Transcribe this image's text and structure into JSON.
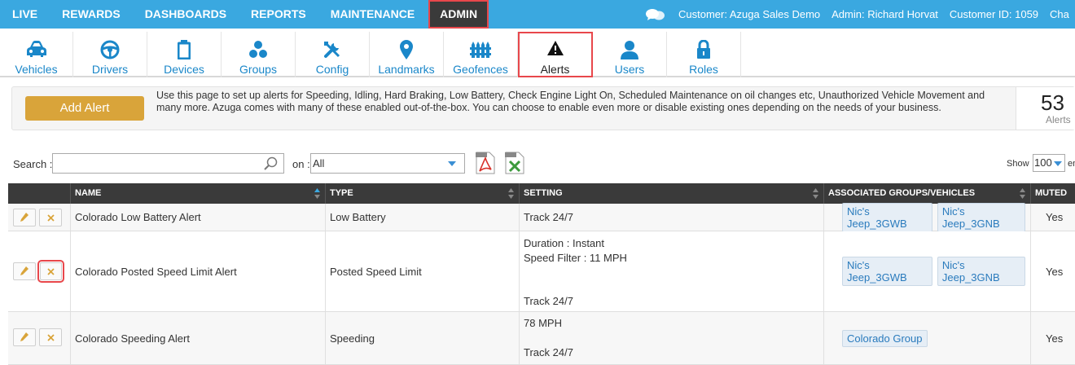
{
  "topnav": {
    "items": [
      "LIVE",
      "REWARDS",
      "DASHBOARDS",
      "REPORTS",
      "MAINTENANCE",
      "ADMIN"
    ],
    "customer": "Customer: Azuga Sales Demo",
    "admin": "Admin: Richard Horvat",
    "customer_id": "Customer ID: 1059",
    "cut_text": "Cha"
  },
  "subnav": {
    "tabs": [
      {
        "label": "Vehicles",
        "icon": "car-icon"
      },
      {
        "label": "Drivers",
        "icon": "steering-wheel-icon"
      },
      {
        "label": "Devices",
        "icon": "device-icon"
      },
      {
        "label": "Groups",
        "icon": "groups-icon"
      },
      {
        "label": "Config",
        "icon": "tools-icon"
      },
      {
        "label": "Landmarks",
        "icon": "map-pin-icon"
      },
      {
        "label": "Geofences",
        "icon": "fence-icon"
      },
      {
        "label": "Alerts",
        "icon": "warning-icon"
      },
      {
        "label": "Users",
        "icon": "user-icon"
      },
      {
        "label": "Roles",
        "icon": "lock-icon"
      }
    ],
    "active": "Alerts"
  },
  "infobar": {
    "add_button": "Add Alert",
    "text": "Use this page to set up alerts for Speeding, Idling, Hard Braking, Low Battery, Check Engine Light On, Scheduled Maintenance on oil changes etc, Unauthorized Vehicle Movement and many more. Azuga comes with many of these enabled out-of-the-box. You can choose to enable even more or disable existing ones depending on the needs of your business.",
    "count": "53",
    "count_label": "Alerts"
  },
  "filters": {
    "search_label": "Search :",
    "search_value": "",
    "on_label": "on :",
    "on_value": "All",
    "show_label": "Show",
    "show_value": "100",
    "entries_label": "en"
  },
  "table": {
    "headers": [
      "NAME",
      "TYPE",
      "SETTING",
      "ASSOCIATED GROUPS/VEHICLES",
      "MUTED"
    ],
    "rows": [
      {
        "name": "Colorado Low Battery Alert",
        "type": "Low Battery",
        "setting": [
          "Track 24/7"
        ],
        "groups": [
          "Nic's Jeep_3GWB",
          "Nic's Jeep_3GNB"
        ],
        "muted": "Yes"
      },
      {
        "name": "Colorado Posted Speed Limit Alert",
        "type": "Posted Speed Limit",
        "setting": [
          "Duration : Instant",
          "Speed Filter : 11 MPH",
          "Track 24/7"
        ],
        "groups": [
          "Nic's Jeep_3GWB",
          "Nic's Jeep_3GNB"
        ],
        "muted": "Yes"
      },
      {
        "name": "Colorado Speeding Alert",
        "type": "Speeding",
        "setting": [
          "78 MPH",
          "Track 24/7"
        ],
        "groups": [
          "Colorado Group"
        ],
        "muted": "Yes"
      }
    ]
  },
  "colors": {
    "topnav_bg": "#3aa8e0",
    "accent_blue": "#1a87c9",
    "add_button": "#d9a43a",
    "highlight": "#e8474b",
    "header_bg": "#3a3a3a"
  }
}
